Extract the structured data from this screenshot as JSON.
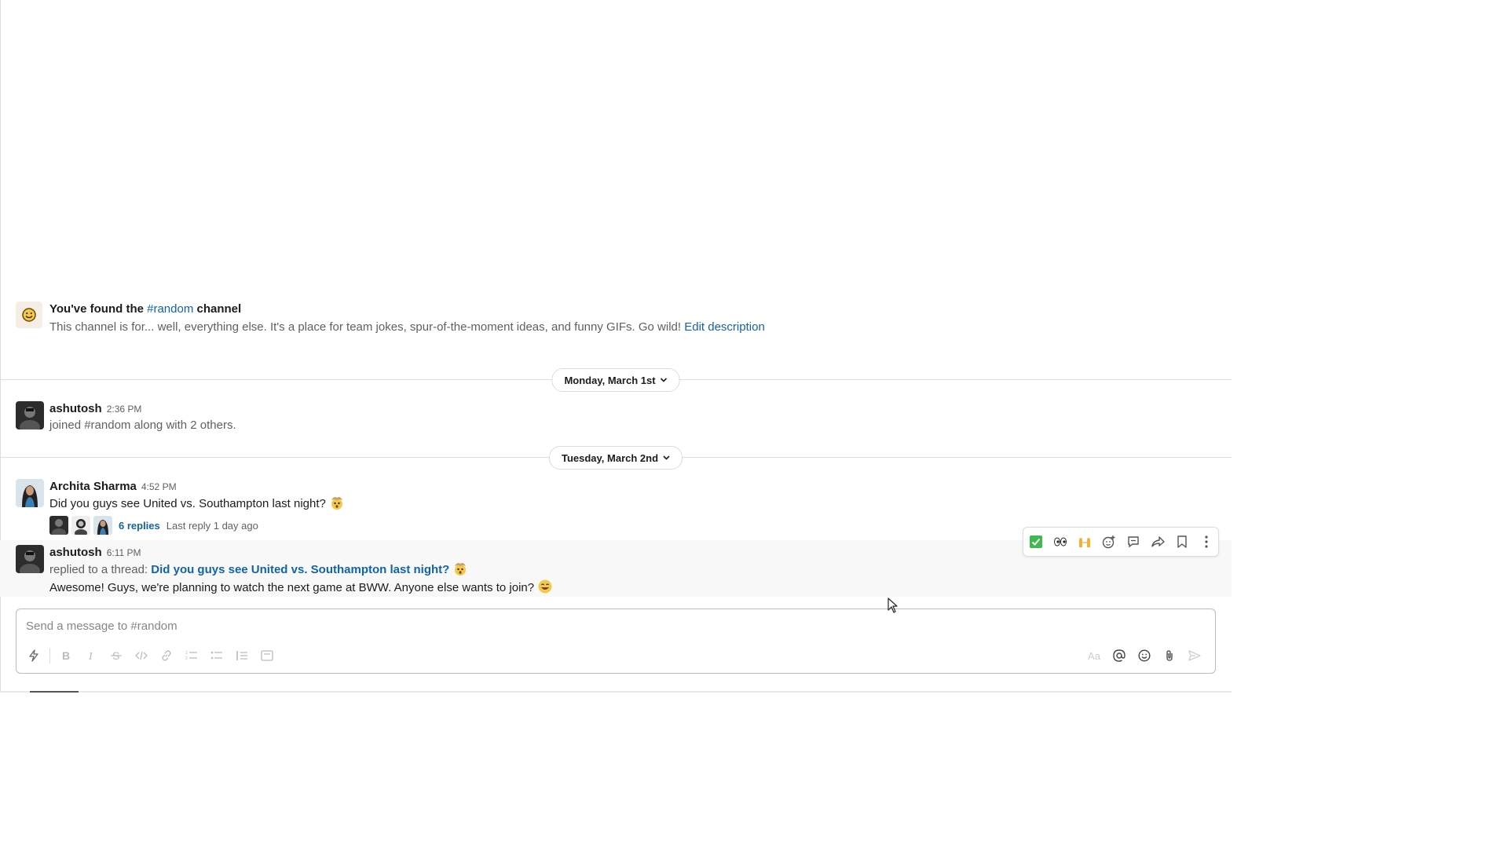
{
  "channel": {
    "intro_title_prefix": "You've found the",
    "intro_channel": "#random",
    "intro_title_suffix": "channel",
    "description": "This channel is for... well, everything else. It's a place for team jokes, spur-of-the-moment ideas, and funny GIFs. Go wild!",
    "edit_description": "Edit description"
  },
  "dates": {
    "first": "Monday, March 1st",
    "second": "Tuesday, March 2nd"
  },
  "messages": [
    {
      "sender": "ashutosh",
      "time": "2:36 PM",
      "text": "joined #random along with 2 others."
    },
    {
      "sender": "Archita Sharma",
      "time": "4:52 PM",
      "text": "Did you guys see United vs. Southampton last night?",
      "replies": "6 replies",
      "last_reply": "Last reply 1 day ago"
    },
    {
      "sender": "ashutosh",
      "time": "6:11 PM",
      "reply_prefix": "replied to a thread:",
      "thread_link": "Did you guys see United vs. Southampton last night?",
      "text": "Awesome! Guys, we're planning to watch the next game at BWW. Anyone else wants to join?"
    }
  ],
  "hover_toolbar": [
    "check-mark-icon",
    "eyes-icon",
    "raised-hands-icon",
    "add-reaction-icon",
    "reply-thread-icon",
    "share-icon",
    "bookmark-icon",
    "more-actions-icon"
  ],
  "composer": {
    "placeholder": "Send a message to #random",
    "format_label": "Aa"
  },
  "colors": {
    "link": "#1264a3",
    "hover_bg": "#f8f8f8"
  }
}
